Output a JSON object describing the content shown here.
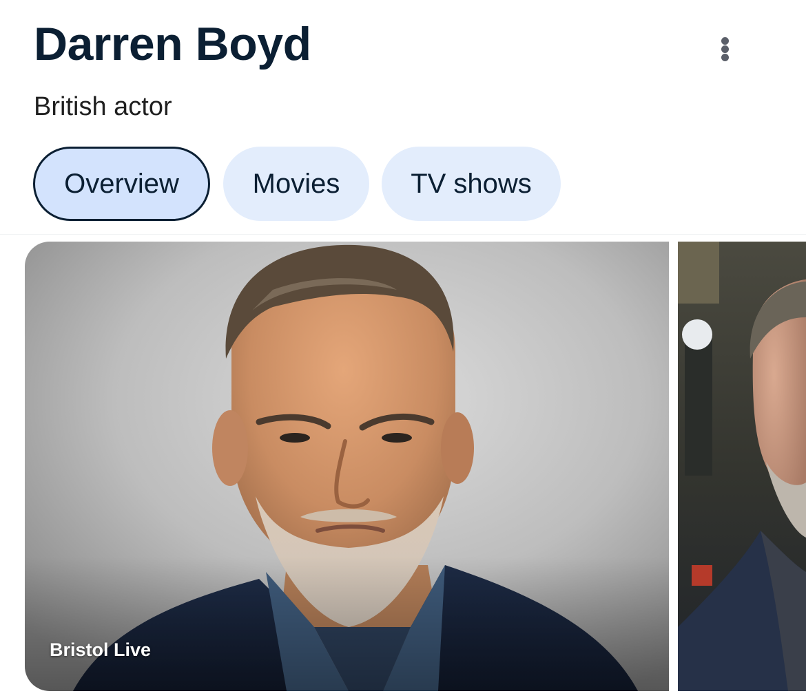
{
  "header": {
    "title": "Darren Boyd",
    "subtitle": "British actor",
    "more_icon": "more-vert-icon"
  },
  "tabs": [
    {
      "label": "Overview",
      "selected": true
    },
    {
      "label": "Movies",
      "selected": false
    },
    {
      "label": "TV shows",
      "selected": false
    }
  ],
  "images": [
    {
      "source": "Bristol Live"
    },
    {
      "source": ""
    }
  ],
  "colors": {
    "title": "#0b1f33",
    "chip_bg": "#e3edfc",
    "chip_selected_bg": "#d3e3fd",
    "chip_selected_border": "#0b1f33"
  }
}
